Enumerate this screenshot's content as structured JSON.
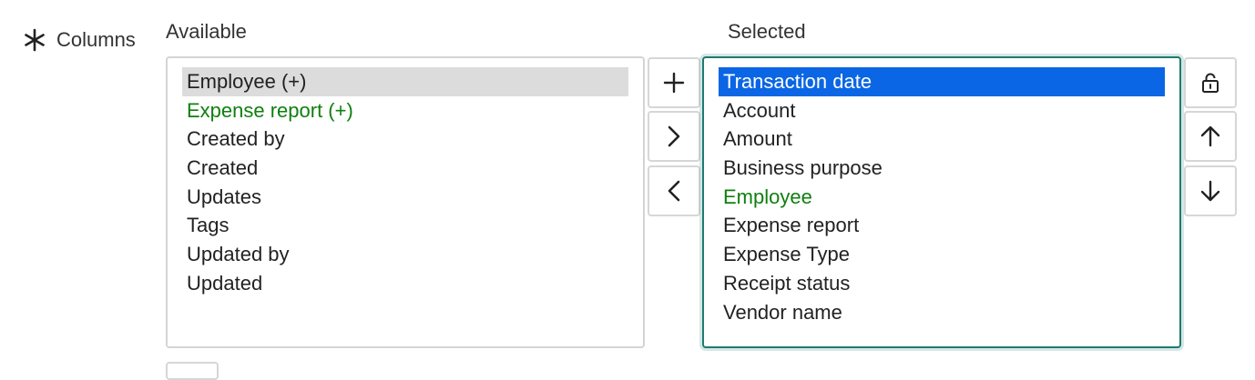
{
  "field": {
    "label": "Columns",
    "required_icon": "asterisk-icon"
  },
  "available": {
    "header": "Available",
    "items": [
      {
        "label": "Employee (+)",
        "state": "hover"
      },
      {
        "label": "Expense report (+)",
        "state": "green"
      },
      {
        "label": "Created by",
        "state": ""
      },
      {
        "label": "Created",
        "state": ""
      },
      {
        "label": "Updates",
        "state": ""
      },
      {
        "label": "Tags",
        "state": ""
      },
      {
        "label": "Updated by",
        "state": ""
      },
      {
        "label": "Updated",
        "state": ""
      }
    ]
  },
  "selected": {
    "header": "Selected",
    "items": [
      {
        "label": "Transaction date",
        "state": "selected"
      },
      {
        "label": "Account",
        "state": ""
      },
      {
        "label": "Amount",
        "state": ""
      },
      {
        "label": "Business purpose",
        "state": ""
      },
      {
        "label": "Employee",
        "state": "green"
      },
      {
        "label": "Expense report",
        "state": ""
      },
      {
        "label": "Expense Type",
        "state": ""
      },
      {
        "label": "Receipt status",
        "state": ""
      },
      {
        "label": "Vendor name",
        "state": ""
      }
    ]
  },
  "transfer_buttons": [
    "plus-icon",
    "chevron-right-icon",
    "chevron-left-icon"
  ],
  "order_buttons": [
    "lock-icon",
    "arrow-up-icon",
    "arrow-down-icon"
  ],
  "colors": {
    "selected_bg": "#0a66e4",
    "hover_bg": "#dcdcdc",
    "green_text": "#0f7f0f",
    "focus_border": "#1d7b6f"
  }
}
